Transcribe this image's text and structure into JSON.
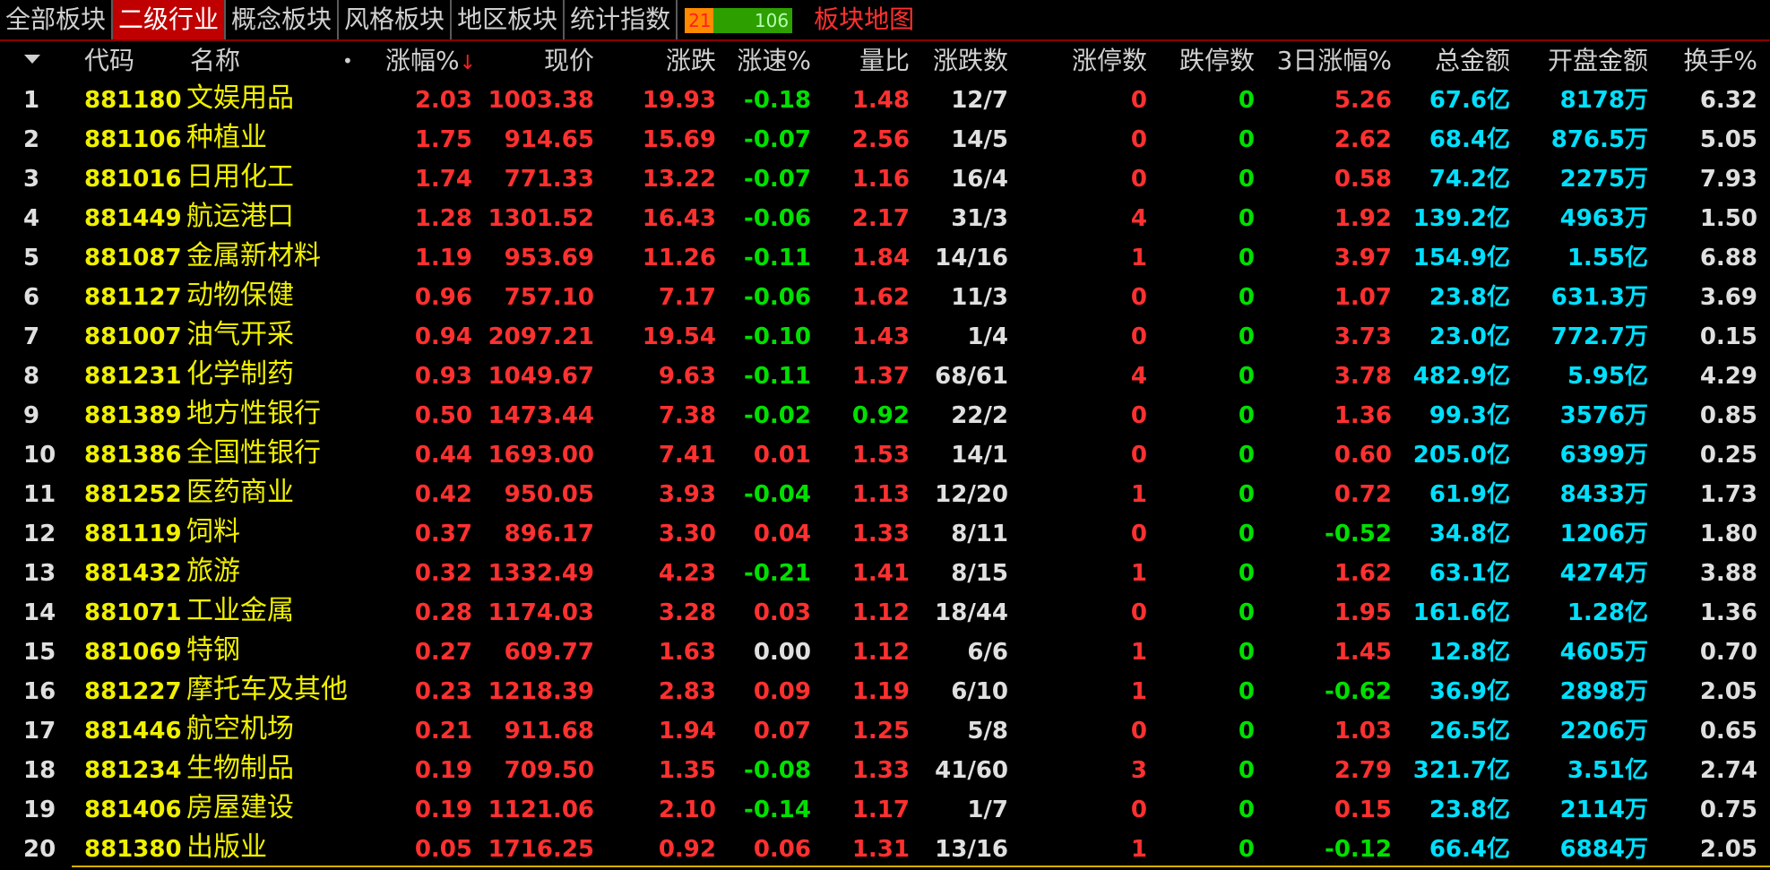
{
  "tabs": [
    {
      "label": "全部板块",
      "active": false
    },
    {
      "label": "二级行业",
      "active": true
    },
    {
      "label": "概念板块",
      "active": false
    },
    {
      "label": "风格板块",
      "active": false
    },
    {
      "label": "地区板块",
      "active": false
    },
    {
      "label": "统计指数",
      "active": false
    }
  ],
  "updown": {
    "up": "21",
    "down": "106"
  },
  "sector_map": "板块地图",
  "headers": {
    "code": "代码",
    "name": "名称",
    "dot": "•",
    "pct": "涨幅%",
    "price": "现价",
    "change": "涨跌",
    "speed": "涨速%",
    "vol_ratio": "量比",
    "updown_count": "涨跌数",
    "limit_up": "涨停数",
    "limit_down": "跌停数",
    "pct3d": "3日涨幅%",
    "total_amount": "总金额",
    "open_amount": "开盘金额",
    "turnover": "换手%"
  },
  "colors": {
    "red": "#ff3030",
    "green": "#00e000",
    "cyan": "#00e0ff",
    "yellow": "#f0f000",
    "accent": "#c00000"
  },
  "rows": [
    {
      "i": "1",
      "code": "881180",
      "name": "文娱用品",
      "pct": "2.03",
      "price": "1003.38",
      "change": "19.93",
      "speed": "-0.18",
      "vr": "1.48",
      "ud": "12/7",
      "lu": "0",
      "ld": "0",
      "p3": "5.26",
      "amt": "67.6亿",
      "oamt": "8178万",
      "to": "6.32"
    },
    {
      "i": "2",
      "code": "881106",
      "name": "种植业",
      "pct": "1.75",
      "price": "914.65",
      "change": "15.69",
      "speed": "-0.07",
      "vr": "2.56",
      "ud": "14/5",
      "lu": "0",
      "ld": "0",
      "p3": "2.62",
      "amt": "68.4亿",
      "oamt": "876.5万",
      "to": "5.05"
    },
    {
      "i": "3",
      "code": "881016",
      "name": "日用化工",
      "pct": "1.74",
      "price": "771.33",
      "change": "13.22",
      "speed": "-0.07",
      "vr": "1.16",
      "ud": "16/4",
      "lu": "0",
      "ld": "0",
      "p3": "0.58",
      "amt": "74.2亿",
      "oamt": "2275万",
      "to": "7.93"
    },
    {
      "i": "4",
      "code": "881449",
      "name": "航运港口",
      "pct": "1.28",
      "price": "1301.52",
      "change": "16.43",
      "speed": "-0.06",
      "vr": "2.17",
      "ud": "31/3",
      "lu": "4",
      "ld": "0",
      "p3": "1.92",
      "amt": "139.2亿",
      "oamt": "4963万",
      "to": "1.50"
    },
    {
      "i": "5",
      "code": "881087",
      "name": "金属新材料",
      "pct": "1.19",
      "price": "953.69",
      "change": "11.26",
      "speed": "-0.11",
      "vr": "1.84",
      "ud": "14/16",
      "lu": "1",
      "ld": "0",
      "p3": "3.97",
      "amt": "154.9亿",
      "oamt": "1.55亿",
      "to": "6.88"
    },
    {
      "i": "6",
      "code": "881127",
      "name": "动物保健",
      "pct": "0.96",
      "price": "757.10",
      "change": "7.17",
      "speed": "-0.06",
      "vr": "1.62",
      "ud": "11/3",
      "lu": "0",
      "ld": "0",
      "p3": "1.07",
      "amt": "23.8亿",
      "oamt": "631.3万",
      "to": "3.69"
    },
    {
      "i": "7",
      "code": "881007",
      "name": "油气开采",
      "pct": "0.94",
      "price": "2097.21",
      "change": "19.54",
      "speed": "-0.10",
      "vr": "1.43",
      "ud": "1/4",
      "lu": "0",
      "ld": "0",
      "p3": "3.73",
      "amt": "23.0亿",
      "oamt": "772.7万",
      "to": "0.15"
    },
    {
      "i": "8",
      "code": "881231",
      "name": "化学制药",
      "pct": "0.93",
      "price": "1049.67",
      "change": "9.63",
      "speed": "-0.11",
      "vr": "1.37",
      "ud": "68/61",
      "lu": "4",
      "ld": "0",
      "p3": "3.78",
      "amt": "482.9亿",
      "oamt": "5.95亿",
      "to": "4.29"
    },
    {
      "i": "9",
      "code": "881389",
      "name": "地方性银行",
      "pct": "0.50",
      "price": "1473.44",
      "change": "7.38",
      "speed": "-0.02",
      "vr": "0.92",
      "ud": "22/2",
      "lu": "0",
      "ld": "0",
      "p3": "1.36",
      "amt": "99.3亿",
      "oamt": "3576万",
      "to": "0.85"
    },
    {
      "i": "10",
      "code": "881386",
      "name": "全国性银行",
      "pct": "0.44",
      "price": "1693.00",
      "change": "7.41",
      "speed": "0.01",
      "vr": "1.53",
      "ud": "14/1",
      "lu": "0",
      "ld": "0",
      "p3": "0.60",
      "amt": "205.0亿",
      "oamt": "6399万",
      "to": "0.25"
    },
    {
      "i": "11",
      "code": "881252",
      "name": "医药商业",
      "pct": "0.42",
      "price": "950.05",
      "change": "3.93",
      "speed": "-0.04",
      "vr": "1.13",
      "ud": "12/20",
      "lu": "1",
      "ld": "0",
      "p3": "0.72",
      "amt": "61.9亿",
      "oamt": "8433万",
      "to": "1.73"
    },
    {
      "i": "12",
      "code": "881119",
      "name": "饲料",
      "pct": "0.37",
      "price": "896.17",
      "change": "3.30",
      "speed": "0.04",
      "vr": "1.33",
      "ud": "8/11",
      "lu": "0",
      "ld": "0",
      "p3": "-0.52",
      "amt": "34.8亿",
      "oamt": "1206万",
      "to": "1.80"
    },
    {
      "i": "13",
      "code": "881432",
      "name": "旅游",
      "pct": "0.32",
      "price": "1332.49",
      "change": "4.23",
      "speed": "-0.21",
      "vr": "1.41",
      "ud": "8/15",
      "lu": "1",
      "ld": "0",
      "p3": "1.62",
      "amt": "63.1亿",
      "oamt": "4274万",
      "to": "3.88"
    },
    {
      "i": "14",
      "code": "881071",
      "name": "工业金属",
      "pct": "0.28",
      "price": "1174.03",
      "change": "3.28",
      "speed": "0.03",
      "vr": "1.12",
      "ud": "18/44",
      "lu": "0",
      "ld": "0",
      "p3": "1.95",
      "amt": "161.6亿",
      "oamt": "1.28亿",
      "to": "1.36"
    },
    {
      "i": "15",
      "code": "881069",
      "name": "特钢",
      "pct": "0.27",
      "price": "609.77",
      "change": "1.63",
      "speed": "0.00",
      "vr": "1.12",
      "ud": "6/6",
      "lu": "1",
      "ld": "0",
      "p3": "1.45",
      "amt": "12.8亿",
      "oamt": "4605万",
      "to": "0.70"
    },
    {
      "i": "16",
      "code": "881227",
      "name": "摩托车及其他",
      "pct": "0.23",
      "price": "1218.39",
      "change": "2.83",
      "speed": "0.09",
      "vr": "1.19",
      "ud": "6/10",
      "lu": "1",
      "ld": "0",
      "p3": "-0.62",
      "amt": "36.9亿",
      "oamt": "2898万",
      "to": "2.05"
    },
    {
      "i": "17",
      "code": "881446",
      "name": "航空机场",
      "pct": "0.21",
      "price": "911.68",
      "change": "1.94",
      "speed": "0.07",
      "vr": "1.25",
      "ud": "5/8",
      "lu": "0",
      "ld": "0",
      "p3": "1.03",
      "amt": "26.5亿",
      "oamt": "2206万",
      "to": "0.65"
    },
    {
      "i": "18",
      "code": "881234",
      "name": "生物制品",
      "pct": "0.19",
      "price": "709.50",
      "change": "1.35",
      "speed": "-0.08",
      "vr": "1.33",
      "ud": "41/60",
      "lu": "3",
      "ld": "0",
      "p3": "2.79",
      "amt": "321.7亿",
      "oamt": "3.51亿",
      "to": "2.74"
    },
    {
      "i": "19",
      "code": "881406",
      "name": "房屋建设",
      "pct": "0.19",
      "price": "1121.06",
      "change": "2.10",
      "speed": "-0.14",
      "vr": "1.17",
      "ud": "1/7",
      "lu": "0",
      "ld": "0",
      "p3": "0.15",
      "amt": "23.8亿",
      "oamt": "2114万",
      "to": "0.75"
    },
    {
      "i": "20",
      "code": "881380",
      "name": "出版业",
      "pct": "0.05",
      "price": "1716.25",
      "change": "0.92",
      "speed": "0.06",
      "vr": "1.31",
      "ud": "13/16",
      "lu": "1",
      "ld": "0",
      "p3": "-0.12",
      "amt": "66.4亿",
      "oamt": "6884万",
      "to": "2.05"
    }
  ]
}
